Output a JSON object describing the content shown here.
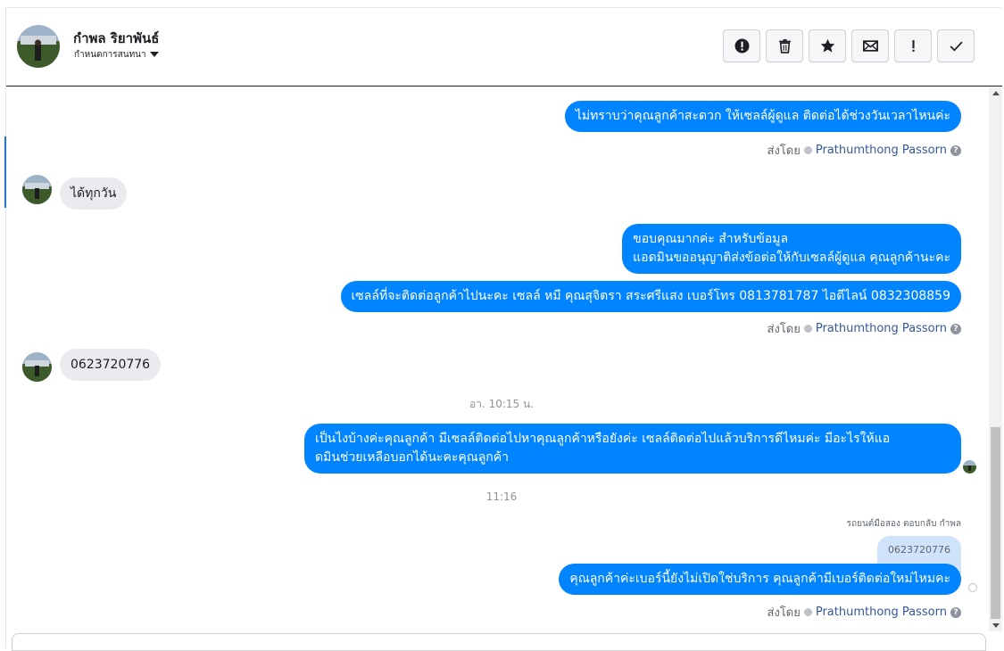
{
  "header": {
    "contact_name": "กำพล ริยาพันธ์",
    "assign_label": "กำหนดการสนทนา",
    "actions": [
      {
        "name": "spam-button",
        "icon": "exclamation-circle-icon"
      },
      {
        "name": "delete-button",
        "icon": "trash-icon"
      },
      {
        "name": "star-button",
        "icon": "star-icon"
      },
      {
        "name": "mark-unread-button",
        "icon": "envelope-icon"
      },
      {
        "name": "follow-up-button",
        "icon": "exclamation-icon"
      },
      {
        "name": "mark-done-button",
        "icon": "checkmark-icon"
      }
    ]
  },
  "messages": {
    "m1": "ไม่ทราบว่าคุณลูกค้าสะดวก ให้เซลล์ผู้ดูแล ติดต่อได้ช่วงวันเวลาไหนค่ะ",
    "sent_by_label": "ส่งโดย",
    "agent_name": "Prathumthong Passorn",
    "m2": "ได้ทุกวัน",
    "m3_line1": "ขอบคุณมากค่ะ สำหรับข้อมูล",
    "m3_line2": "แอดมินขออนุญาติส่งข้อต่อให้กับเซลล์ผู้ดูแล คุณลูกค้านะคะ",
    "m4": "เซลล์ที่จะติดต่อลูกค้าไปนะคะ เซลล์ หมี คุณสุจิตรา สระศรีแสง เบอร์โทร 0813781787 ไอดีไลน์ 0832308859",
    "m5": "0623720776",
    "time1": "อา. 10:15 น.",
    "m6_line1": "เป็นไงบ้างค่ะคุณลูกค้า มีเซลล์ติดต่อไปหาคุณลูกค้าหรือยังค่ะ  เซลล์ติดต่อไปแล้วบริการดีไหมค่ะ มีอะไรให้แอ",
    "m6_line2": "ดมินช่วยเหลือบอกได้นะคะคุณลูกค้า",
    "time2": "11:16",
    "reply_note": "รถยนต์มือสอง ตอบกลับ กำพล",
    "quoted": "0623720776",
    "m7": "คุณลูกค้าค่ะเบอร์นี้ยังไม่เปิดใช่บริการ คุณลูกค้ามีเบอร์ติดต่อใหม่ไหมคะ"
  },
  "colors": {
    "outgoing_bubble": "#0084ff",
    "incoming_bubble": "#e9ebee",
    "accent": "#1877f2"
  }
}
